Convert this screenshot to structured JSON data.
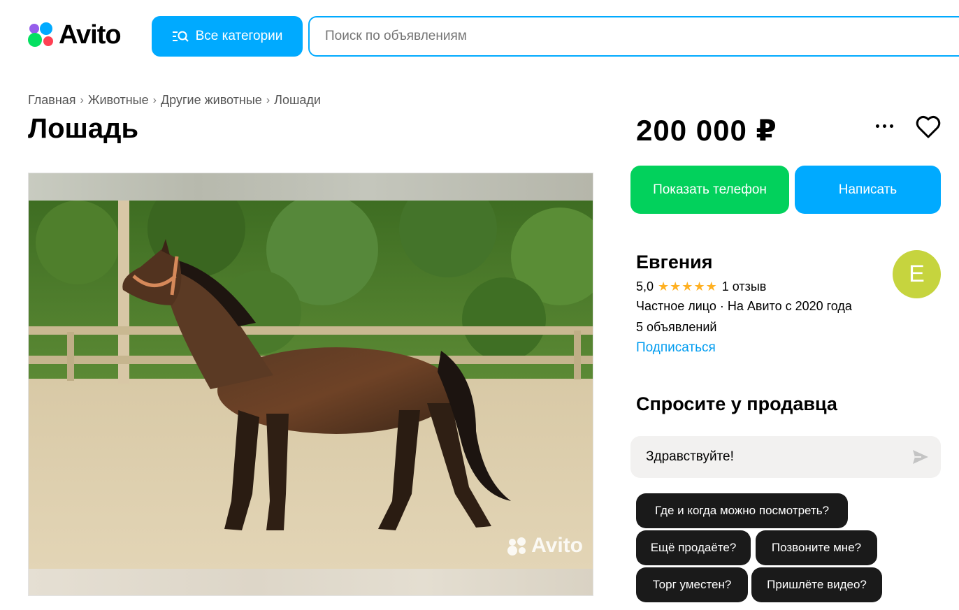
{
  "header": {
    "logo_text": "Avito",
    "categories_label": "Все категории",
    "search_placeholder": "Поиск по объявлениям"
  },
  "breadcrumb": [
    "Главная",
    "Животные",
    "Другие животные",
    "Лошади"
  ],
  "listing": {
    "title": "Лошадь",
    "price": "200 000 ₽",
    "photo_watermark": "Avito"
  },
  "actions": {
    "show_phone": "Показать телефон",
    "write": "Написать"
  },
  "seller": {
    "name": "Евгения",
    "rating": "5,0",
    "stars": "★★★★★",
    "reviews": "1 отзыв",
    "type": "Частное лицо · На Авито с 2020 года",
    "ads_count": "5 объявлений",
    "subscribe": "Подписаться",
    "avatar_letter": "Е"
  },
  "ask": {
    "title": "Спросите у продавца",
    "message": "Здравствуйте!",
    "chips": [
      "Где и когда можно посмотреть?",
      "Ещё продаёте?",
      "Позвоните мне?",
      "Торг уместен?",
      "Пришлёте видео?"
    ]
  },
  "colors": {
    "accent_blue": "#00aaff",
    "accent_green": "#02d15c",
    "avatar_bg": "#c6d43e",
    "star": "#ffb021"
  }
}
